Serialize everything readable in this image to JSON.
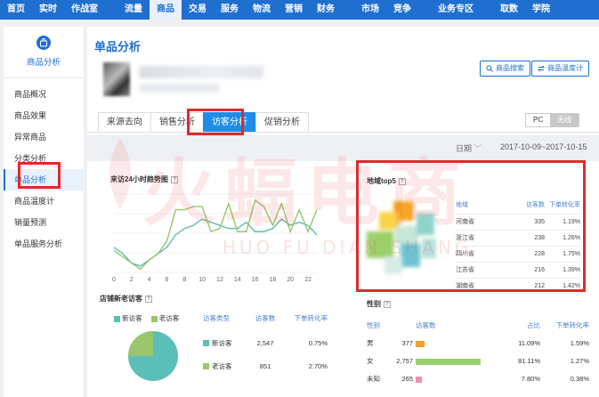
{
  "topnav": {
    "items": [
      "首页",
      "实时",
      "作战室",
      "流量",
      "商品",
      "交易",
      "服务",
      "物流",
      "营销",
      "财务",
      "市场",
      "竞争",
      "业务专区",
      "取数",
      "学院"
    ],
    "active_index": 4,
    "bg_color": "#1f6fd1"
  },
  "sidebar": {
    "title": "商品分析",
    "icon": "shop-bag-icon",
    "items": [
      "商品概况",
      "商品效果",
      "异常商品",
      "分类分析",
      "单品分析",
      "商品温度计",
      "销量预测",
      "单品服务分析"
    ],
    "active_index": 4
  },
  "main": {
    "page_title": "单品分析",
    "btn_search": "商品搜索",
    "btn_thermo": "商品温度计",
    "tabs": [
      "来源去向",
      "销售分析",
      "访客分析",
      "促销分析"
    ],
    "active_tab": 2,
    "toggle": [
      "PC",
      "无线"
    ],
    "toggle_active": 1,
    "date_label": "日期",
    "date_value": "2017-10-09~2017-10-15"
  },
  "trend": {
    "title": "来访24小时趋势图",
    "x_ticks": [
      "0",
      "2",
      "4",
      "6",
      "8",
      "10",
      "12",
      "14",
      "16",
      "18",
      "20",
      "22"
    ]
  },
  "chart_data": {
    "type": "line",
    "title": "来访24小时趋势图",
    "x": [
      0,
      1,
      2,
      3,
      4,
      5,
      6,
      7,
      8,
      9,
      10,
      11,
      12,
      13,
      14,
      15,
      16,
      17,
      18,
      19,
      20,
      21,
      22,
      23
    ],
    "series": [
      {
        "values": [
          8,
          6,
          3,
          2,
          4,
          6,
          8,
          12,
          14,
          15,
          17,
          16,
          15,
          14,
          14,
          16,
          13,
          13,
          14,
          17,
          15,
          16,
          15,
          12
        ],
        "color": "#5bbfb8"
      },
      {
        "values": [
          7,
          5,
          3,
          1,
          4,
          6,
          10,
          20,
          20,
          21,
          21,
          13,
          14,
          22,
          13,
          13,
          23,
          21,
          15,
          22,
          13,
          20,
          13,
          20
        ],
        "color": "#9bc56a"
      }
    ],
    "ylim": [
      0,
      25
    ],
    "grid": true
  },
  "visitors": {
    "title": "店铺新老访客",
    "legend_new": "新访客",
    "legend_old": "老访客",
    "col_type": "访客类型",
    "col_count": "访客数",
    "col_rate": "下单转化率",
    "rows": [
      {
        "type": "新访客",
        "count": "2,547",
        "rate": "0.75%",
        "color": "#5bbfb8"
      },
      {
        "type": "老访客",
        "count": "851",
        "rate": "2.70%",
        "color": "#9bc56a"
      }
    ],
    "pie_new_fraction": 0.75
  },
  "region": {
    "title": "地域top5",
    "col_region": "地域",
    "col_count": "访客数",
    "col_rate": "下单转化率",
    "rows": [
      {
        "name": "河南省",
        "count": "335",
        "rate": "1.19%"
      },
      {
        "name": "浙江省",
        "count": "238",
        "rate": "1.26%"
      },
      {
        "name": "四川省",
        "count": "228",
        "rate": "1.75%"
      },
      {
        "name": "江苏省",
        "count": "216",
        "rate": "1.39%"
      },
      {
        "name": "湖南省",
        "count": "212",
        "rate": "1.42%"
      }
    ]
  },
  "gender": {
    "title": "性别",
    "col_gender": "性别",
    "col_count": "访客数",
    "col_share": "占比",
    "col_rate": "下单转化率",
    "rows": [
      {
        "name": "男",
        "count": "377",
        "share": "11.09%",
        "rate": "1.59%",
        "color": "#f0a030",
        "fraction": 0.11
      },
      {
        "name": "女",
        "count": "2,757",
        "share": "81.11%",
        "rate": "1.27%",
        "color": "#9bd06a",
        "fraction": 0.81
      },
      {
        "name": "未知",
        "count": "265",
        "share": "7.80%",
        "rate": "0.38%",
        "color": "#f08fb0",
        "fraction": 0.078
      }
    ]
  },
  "watermark": {
    "text": "火蝠电商",
    "sub": "HUO FU DIAN SHANG"
  }
}
